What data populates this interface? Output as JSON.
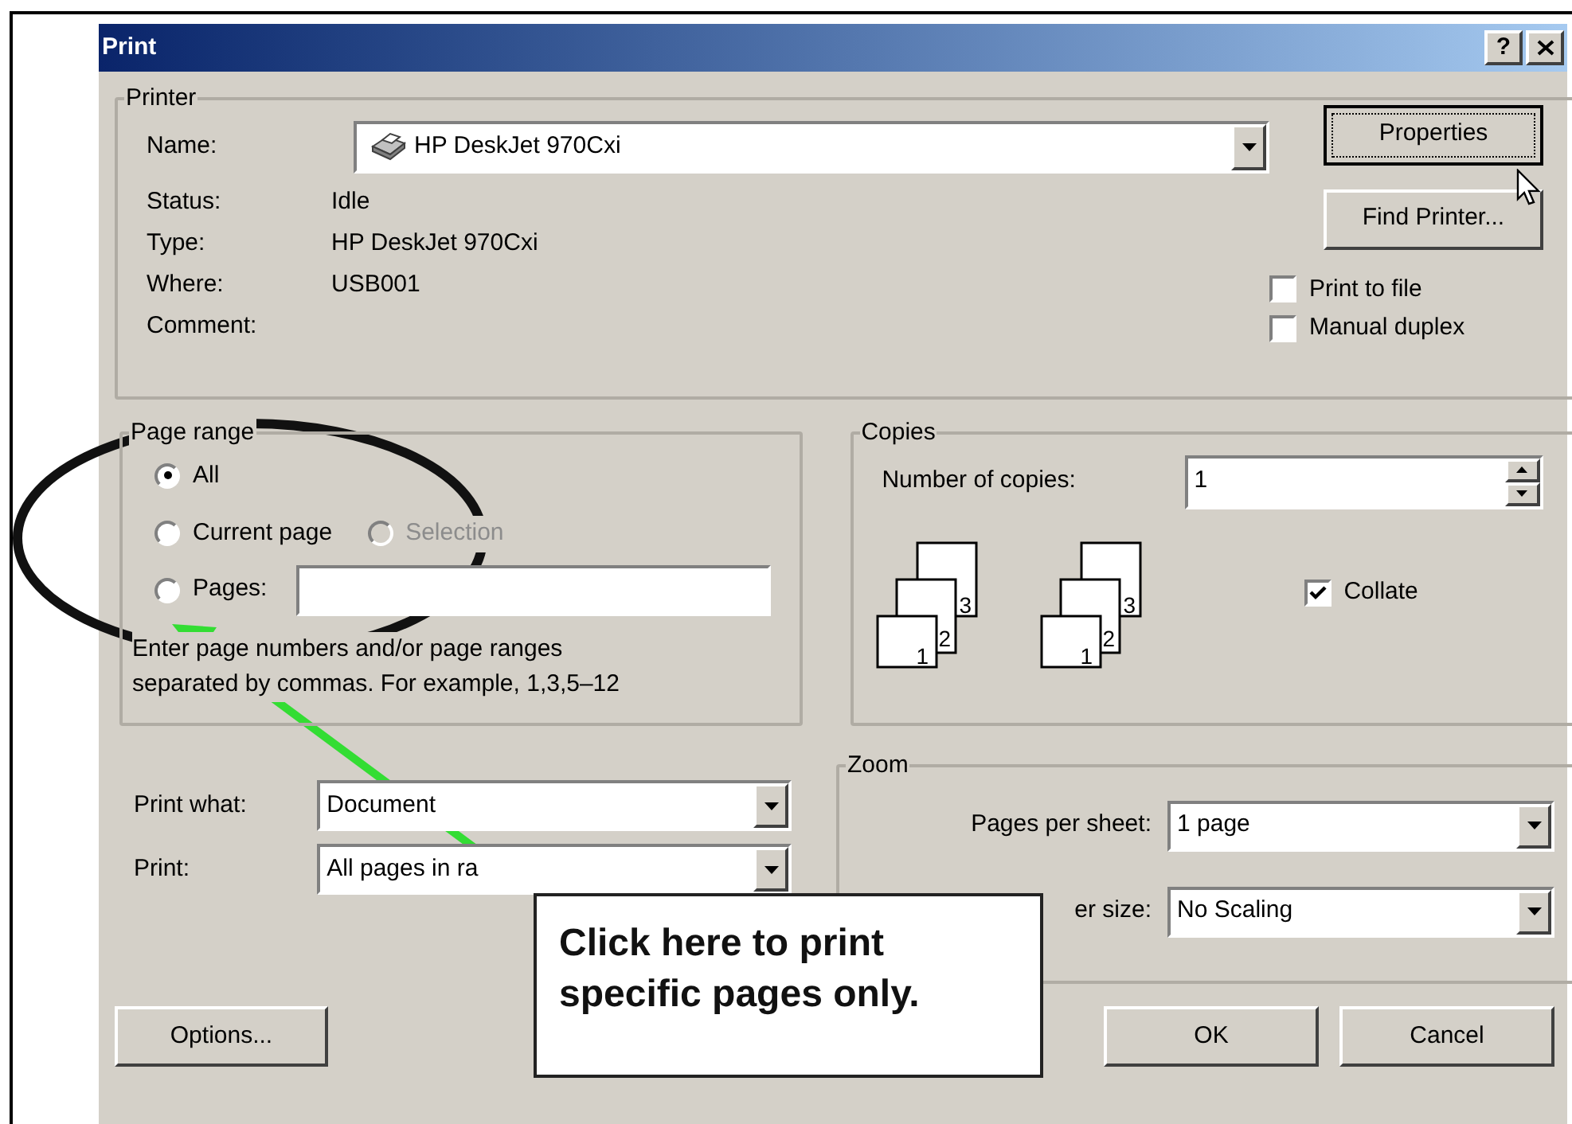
{
  "window": {
    "title": "Print",
    "help_button": "?"
  },
  "printer": {
    "title": "Printer",
    "name_label": "Name:",
    "name_value": "HP DeskJet 970Cxi",
    "info": [
      {
        "label": "Status:",
        "value": "Idle"
      },
      {
        "label": "Type:",
        "value": "HP DeskJet 970Cxi"
      },
      {
        "label": "Where:",
        "value": "USB001"
      },
      {
        "label": "Comment:"
      }
    ],
    "buttons": [
      {
        "label": "Properties",
        "focused": true
      },
      {
        "label": "Find Printer...",
        "focused": false
      }
    ],
    "checkboxes": [
      {
        "label": "Print to file",
        "checked": false
      },
      {
        "label": "Manual duplex",
        "checked": false
      }
    ]
  },
  "page_range": {
    "title": "Page range",
    "options": [
      {
        "label": "All",
        "selected": true,
        "disabled": false
      },
      {
        "label": "Current page",
        "selected": false,
        "disabled": false
      },
      {
        "label": "Selection",
        "selected": false,
        "disabled": true
      },
      {
        "label": "Pages:",
        "selected": false,
        "disabled": false
      }
    ],
    "hint_lines": [
      "Enter page numbers and/or page ranges",
      "separated by commas.  For example, 1,3,5–12"
    ]
  },
  "copies": {
    "title": "Copies",
    "label": "Number of copies:",
    "value": "1",
    "stacks": [
      {
        "pages": [
          "1",
          "2",
          "3"
        ]
      },
      {
        "pages": [
          "1",
          "2",
          "3"
        ]
      }
    ],
    "collate": {
      "label": "Collate",
      "checked": true
    }
  },
  "print_what": {
    "label": "Print what:",
    "value": "Document"
  },
  "print": {
    "label": "Print:",
    "value": "All pages in ra"
  },
  "zoom": {
    "title": "Zoom",
    "rows": [
      {
        "label": "Pages per sheet:",
        "value": "1 page"
      },
      {
        "label": "er size:",
        "value": "No Scaling"
      }
    ]
  },
  "footer_buttons": [
    {
      "label": "Options..."
    },
    {
      "label": "OK"
    },
    {
      "label": "Cancel"
    }
  ],
  "callout": {
    "lines": [
      "Click here to print",
      "specific pages only."
    ]
  }
}
